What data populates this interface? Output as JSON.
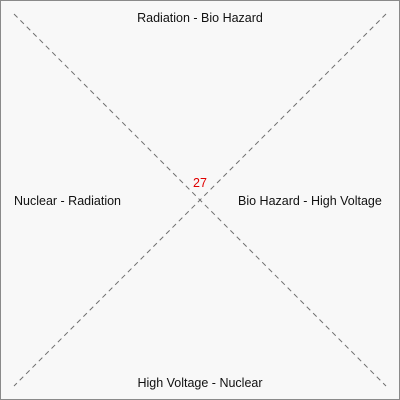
{
  "labels": {
    "top": "Radiation - Bio Hazard",
    "bottom": "High Voltage - Nuclear",
    "left": "Nuclear - Radiation",
    "right": "Bio Hazard - High Voltage"
  },
  "center_value": "27",
  "colors": {
    "background": "#f8f8f8",
    "border": "#8a8a8a",
    "diagonal_lines": "#707070",
    "label_text": "#111111",
    "center_value": "#e00000"
  }
}
